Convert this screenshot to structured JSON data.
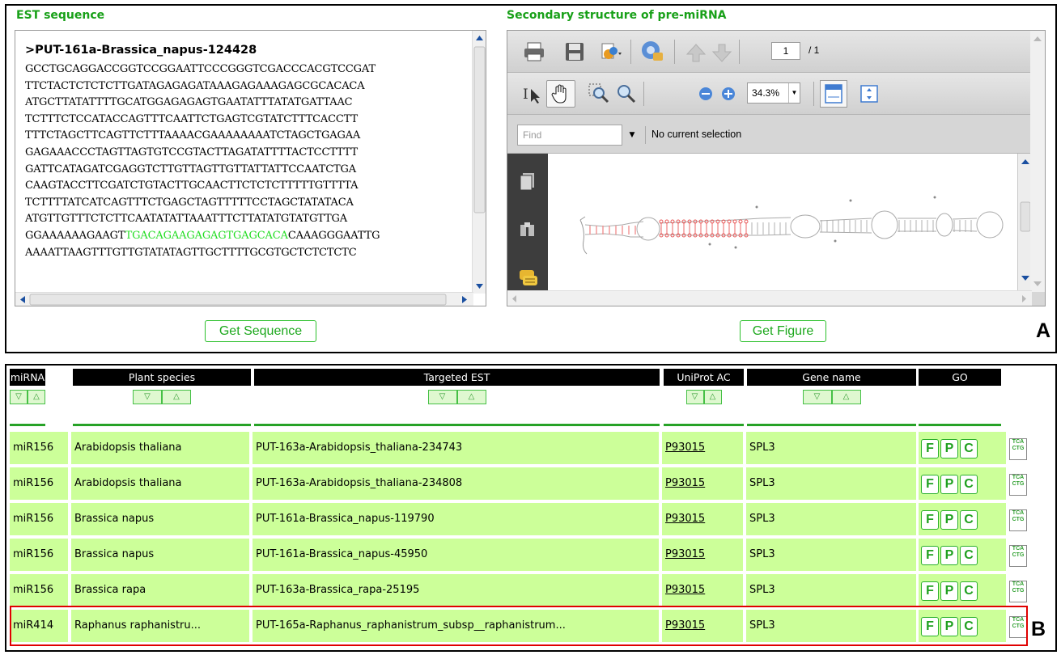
{
  "panel_a": {
    "label": "A",
    "est_title": "EST sequence",
    "structure_title": "Secondary structure of pre-miRNA",
    "sequence": {
      "header": ">PUT-161a-Brassica_napus-124428",
      "lines": [
        "GCCTGCAGGACCGGTCCGGAATTCCCGGGTCGACCCACGTCCGAT",
        "TTCTACTCTCTCTTGATAGAGAGATAAAGAGAAAGAGCGCACACA",
        "ATGCTTATATTTTGCATGGAGAGAGTGAATATTTATATGATTAAC",
        "TCTTTCTCCATACCAGTTTCAATTCTGAGTCGTATCTTTCACCTT",
        "TTTCTAGCTTCAGTTCTTTAAAACGAAAAAAAATCTAGCTGAGAA",
        "GAGAAACCCTAGTTAGTGTCCGTACTTAGATATTTTACTCCTTTT",
        "GATTCATAGATCGAGGTCTTGTTAGTTGTTATTATTCCAATCTGA",
        "CAAGTACCTTCGATCTGTACTTGCAACTTCTCTCTTTTTGTTTTA",
        "TCTTTTATCATCAGTTTCTGAGCTAGTTTTTCCTAGCTATATACA",
        "ATGTTGTTTCTCTTCAATATATTAAATTTCTTATATGTATGTTGA"
      ],
      "highlight_line": {
        "before": "GGAAAAAAGAAGT",
        "highlight": "TGACAGAAGAGAGTGAGCACA",
        "after": "CAAAGGGAATTG"
      },
      "last_line": "AAAATTAAGTTTGTTGTATATAGTTGCTTTTGCGTGCTCTCTCTC"
    },
    "get_sequence_label": "Get Sequence",
    "get_figure_label": "Get Figure",
    "pdf_viewer": {
      "page_current": "1",
      "page_total": "/ 1",
      "zoom": "34.3%",
      "find_placeholder": "Find",
      "selection_status": "No current selection",
      "icons": [
        "print-icon",
        "save-icon",
        "share-icon",
        "settings-icon",
        "page-up-icon",
        "page-down-icon",
        "select-tool-icon",
        "hand-tool-icon",
        "marquee-zoom-icon",
        "dynamic-zoom-icon",
        "zoom-out-icon",
        "zoom-in-icon",
        "fit-width-icon",
        "fit-page-icon",
        "pages-panel-icon",
        "bookmarks-icon",
        "comments-icon"
      ]
    }
  },
  "panel_b": {
    "label": "B",
    "columns": [
      "miRNA",
      "Plant species",
      "Targeted EST",
      "UniProt AC",
      "Gene name",
      "GO"
    ],
    "sort_down": "▽",
    "sort_up": "△",
    "go_buttons": [
      "F",
      "P",
      "C"
    ],
    "tca_icon": [
      "TCA",
      "CTG"
    ],
    "rows": [
      {
        "mirna": "miR156",
        "species": "Arabidopsis thaliana",
        "est": "PUT-163a-Arabidopsis_thaliana-234743",
        "uniprot": "P93015",
        "gene": "SPL3"
      },
      {
        "mirna": "miR156",
        "species": "Arabidopsis thaliana",
        "est": "PUT-163a-Arabidopsis_thaliana-234808",
        "uniprot": "P93015",
        "gene": "SPL3"
      },
      {
        "mirna": "miR156",
        "species": "Brassica napus",
        "est": "PUT-161a-Brassica_napus-119790",
        "uniprot": "P93015",
        "gene": "SPL3"
      },
      {
        "mirna": "miR156",
        "species": "Brassica napus",
        "est": "PUT-161a-Brassica_napus-45950",
        "uniprot": "P93015",
        "gene": "SPL3"
      },
      {
        "mirna": "miR156",
        "species": "Brassica rapa",
        "est": "PUT-163a-Brassica_rapa-25195",
        "uniprot": "P93015",
        "gene": "SPL3"
      },
      {
        "mirna": "miR414",
        "species": "Raphanus raphanistru...",
        "est": "PUT-165a-Raphanus_raphanistrum_subsp__raphanistrum...",
        "uniprot": "P93015",
        "gene": "SPL3"
      }
    ]
  },
  "colors": {
    "title_green": "#18a018",
    "row_green": "#ccff99",
    "highlight_red": "#e00000",
    "mirna_highlight": "#22dd22"
  }
}
